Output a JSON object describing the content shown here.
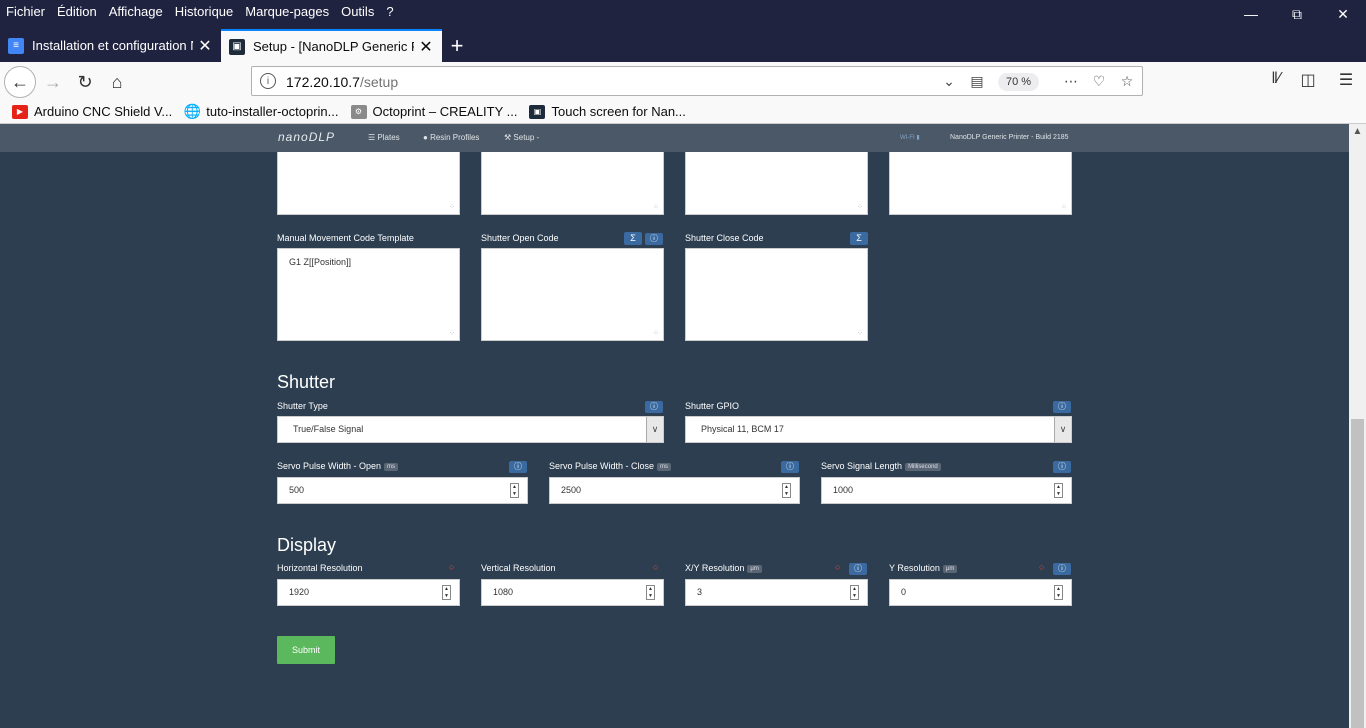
{
  "browser": {
    "menu": [
      "Fichier",
      "Édition",
      "Affichage",
      "Historique",
      "Marque-pages",
      "Outils",
      "?"
    ],
    "tabs": [
      {
        "title": "Installation et configuration Na",
        "active": false
      },
      {
        "title": "Setup - [NanoDLP Generic Print",
        "active": true
      }
    ],
    "url_host": "172.20.10.7",
    "url_path": "/setup",
    "zoom": "70 %",
    "bookmarks": [
      {
        "label": "Arduino CNC Shield V...",
        "icon": "youtube-icon"
      },
      {
        "label": "tuto-installer-octoprin...",
        "icon": "globe-icon"
      },
      {
        "label": "Octoprint – CREALITY ...",
        "icon": "site-icon"
      },
      {
        "label": "Touch screen for Nan...",
        "icon": "nanodlp-icon"
      }
    ]
  },
  "app": {
    "logo": "nanoDLP",
    "nav": [
      "Plates",
      "Resin Profiles",
      "Setup -"
    ],
    "wifi": "WI-FI",
    "build": "NanoDLP Generic Printer - Build 2185"
  },
  "codes": {
    "manual_label": "Manual Movement Code Template",
    "manual_value": "G1 Z[[Position]]",
    "shutter_open_label": "Shutter Open Code",
    "shutter_close_label": "Shutter Close Code",
    "sigma": "Σ"
  },
  "shutter": {
    "heading": "Shutter",
    "type_label": "Shutter Type",
    "type_value": "True/False Signal",
    "gpio_label": "Shutter GPIO",
    "gpio_value": "Physical 11, BCM 17",
    "servo_open_label": "Servo Pulse Width - Open",
    "servo_open_unit": "ms",
    "servo_open_value": "500",
    "servo_close_label": "Servo Pulse Width - Close",
    "servo_close_unit": "ms",
    "servo_close_value": "2500",
    "signal_len_label": "Servo Signal Length",
    "signal_len_unit": "Millisecond",
    "signal_len_value": "1000"
  },
  "display": {
    "heading": "Display",
    "hres_label": "Horizontal Resolution",
    "hres_value": "1920",
    "vres_label": "Vertical Resolution",
    "vres_value": "1080",
    "xy_label": "X/Y Resolution",
    "xy_unit": "μm",
    "xy_value": "3",
    "y_label": "Y Resolution",
    "y_unit": "μm",
    "y_value": "0"
  },
  "submit_label": "Submit",
  "colors": {
    "page_bg": "#2c3e50",
    "nav_bg": "#4b5867",
    "submit": "#5cb85c",
    "help": "#3a6aa0",
    "required": "#e74c3c"
  }
}
